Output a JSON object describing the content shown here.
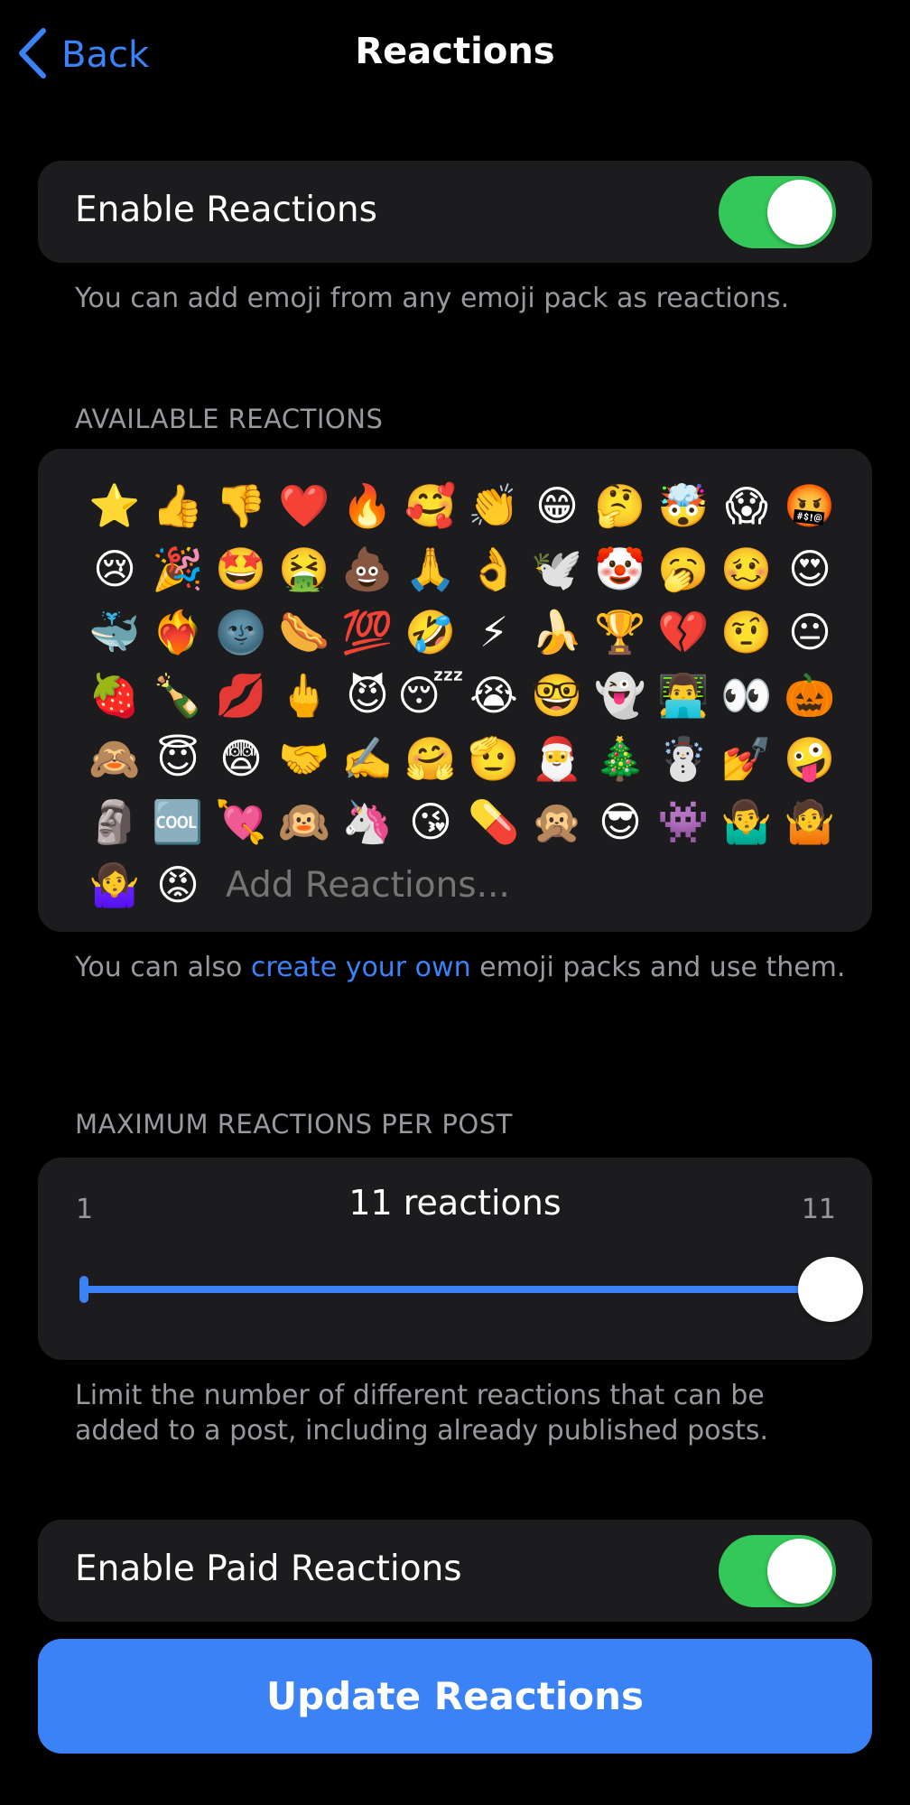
{
  "nav": {
    "back_label": "Back",
    "title": "Reactions"
  },
  "enable_reactions": {
    "label": "Enable Reactions",
    "enabled": true,
    "footnote": "You can add emoji from any emoji pack as reactions."
  },
  "available_reactions": {
    "header": "AVAILABLE REACTIONS",
    "rows": [
      [
        "⭐",
        "👍",
        "👎",
        "❤️",
        "🔥",
        "🥰",
        "👏",
        "😁",
        "🤔",
        "🤯",
        "😱",
        "🤬"
      ],
      [
        "😢",
        "🎉",
        "🤩",
        "🤮",
        "💩",
        "🙏",
        "👌",
        "🕊️",
        "🤡",
        "🥱",
        "🥴",
        "😍"
      ],
      [
        "🐳",
        "❤️‍🔥",
        "🌚",
        "🌭",
        "💯",
        "🤣",
        "⚡",
        "🍌",
        "🏆",
        "💔",
        "🤨",
        "😐"
      ],
      [
        "🍓",
        "🍾",
        "💋",
        "🖕",
        "😈",
        "😴",
        "😭",
        "🤓",
        "👻",
        "👨‍💻",
        "👀",
        "🎃"
      ],
      [
        "🙈",
        "😇",
        "😨",
        "🤝",
        "✍️",
        "🤗",
        "🫡",
        "🎅",
        "🎄",
        "☃️",
        "💅",
        "🤪"
      ],
      [
        "🗿",
        "🆒",
        "💘",
        "🙉",
        "🦄",
        "😘",
        "💊",
        "🙊",
        "😎",
        "👾",
        "🤷‍♂️",
        "🤷"
      ]
    ],
    "last_row": [
      "🤷‍♀️",
      "😡"
    ],
    "add_placeholder": "Add Reactions...",
    "footnote_prefix": "You can also ",
    "footnote_link": "create your own",
    "footnote_suffix": " emoji packs and use them."
  },
  "max_reactions": {
    "header": "MAXIMUM REACTIONS PER POST",
    "min_label": "1",
    "max_label": "11",
    "value_label": "11 reactions",
    "value": 11,
    "min": 1,
    "max": 11,
    "footnote": "Limit the number of different reactions that can be added to a post, including already published posts."
  },
  "paid_reactions": {
    "label": "Enable Paid Reactions",
    "enabled": true
  },
  "primary_button": {
    "label": "Update Reactions"
  },
  "colors": {
    "accent": "#3b82f6",
    "toggle_on": "#34c759",
    "card_bg": "#1c1c1e",
    "secondary_text": "#98989f"
  }
}
